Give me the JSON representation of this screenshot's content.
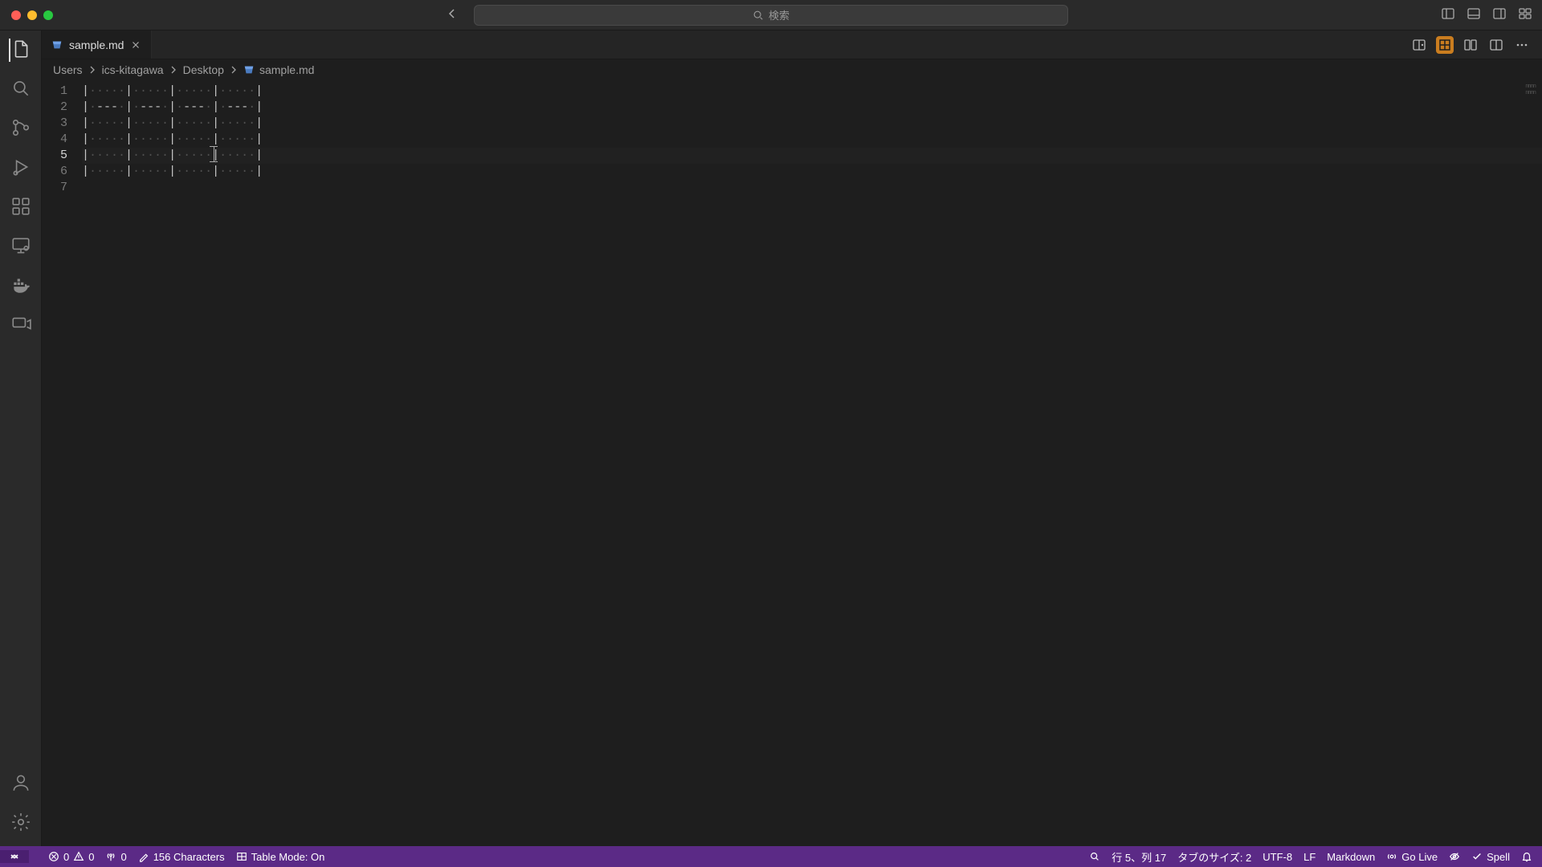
{
  "search_placeholder": "検索",
  "tab": {
    "filename": "sample.md"
  },
  "breadcrumb": {
    "parts": [
      "Users",
      "ics-kitagawa",
      "Desktop"
    ],
    "file": "sample.md"
  },
  "editor": {
    "line_numbers": [
      "1",
      "2",
      "3",
      "4",
      "5",
      "6",
      "7"
    ],
    "active_line_index": 4,
    "cursor": {
      "line": 5,
      "col": 17
    }
  },
  "status": {
    "errors": "0",
    "warnings": "0",
    "ports": "0",
    "chars": "156 Characters",
    "table_mode": "Table Mode: On",
    "cursor": "行 5、列 17",
    "tabsize": "タブのサイズ: 2",
    "encoding": "UTF-8",
    "eol": "LF",
    "language": "Markdown",
    "golive": "Go Live",
    "spell": "Spell"
  }
}
